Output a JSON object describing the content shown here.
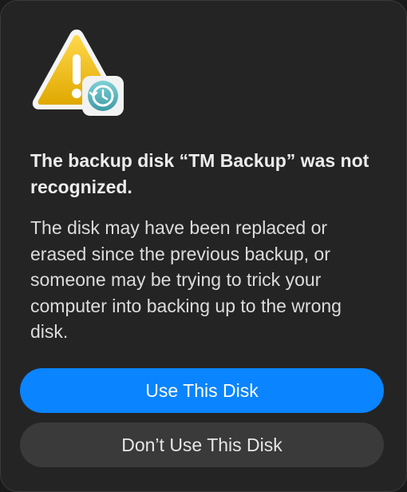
{
  "dialog": {
    "title": "The backup disk “TM Backup” was not recognized.",
    "message": "The disk may have been replaced or erased since the previous backup, or someone may be trying to trick your computer into backing up to the wrong disk.",
    "icon": "warning-triangle-with-time-machine-badge"
  },
  "buttons": {
    "primary_label": "Use This Disk",
    "secondary_label": "Don’t Use This Disk"
  },
  "colors": {
    "accent": "#0a84ff",
    "warning": "#f4c20d",
    "badge": "#5fb7c0"
  }
}
